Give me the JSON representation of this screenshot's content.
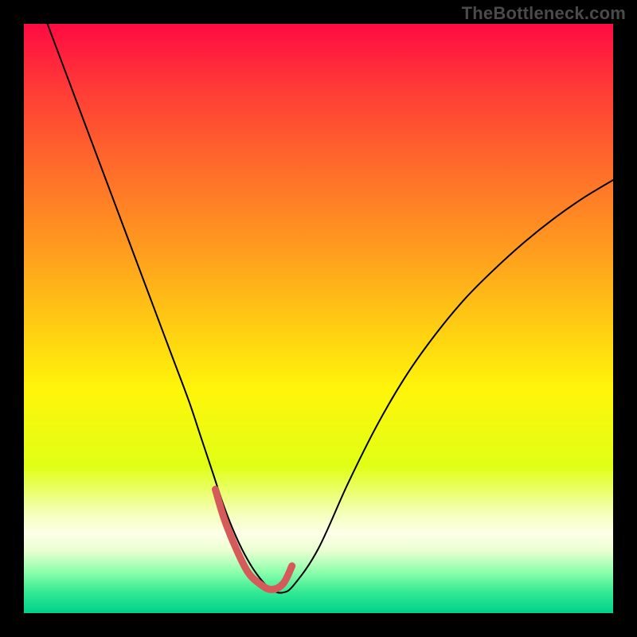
{
  "watermark": "TheBottleneck.com",
  "chart_data": {
    "type": "line",
    "title": "",
    "xlabel": "",
    "ylabel": "",
    "xlim": [
      0,
      100
    ],
    "ylim": [
      0,
      100
    ],
    "grid": false,
    "legend": false,
    "background": {
      "type": "vertical-gradient",
      "stops": [
        {
          "pos": 0.0,
          "color": "#ff0b42"
        },
        {
          "pos": 0.12,
          "color": "#ff3f36"
        },
        {
          "pos": 0.25,
          "color": "#ff6e2a"
        },
        {
          "pos": 0.38,
          "color": "#ff9b1f"
        },
        {
          "pos": 0.5,
          "color": "#ffc814"
        },
        {
          "pos": 0.62,
          "color": "#fff50a"
        },
        {
          "pos": 0.75,
          "color": "#e0ff15"
        },
        {
          "pos": 0.83,
          "color": "#f4ffb8"
        },
        {
          "pos": 0.865,
          "color": "#feffe8"
        },
        {
          "pos": 0.895,
          "color": "#e8ffd0"
        },
        {
          "pos": 0.93,
          "color": "#8dffac"
        },
        {
          "pos": 0.965,
          "color": "#32e993"
        },
        {
          "pos": 1.0,
          "color": "#00d18b"
        }
      ]
    },
    "series": [
      {
        "name": "bottleneck-curve",
        "stroke": "#000000",
        "stroke_width": 2,
        "x": [
          4,
          7,
          10,
          13,
          16,
          19,
          22,
          25,
          28,
          30,
          32,
          34,
          36,
          38,
          40,
          42,
          44,
          46,
          50,
          55,
          60,
          65,
          70,
          75,
          80,
          85,
          90,
          95,
          100
        ],
        "y": [
          100,
          92,
          84,
          76,
          68,
          60,
          52,
          44,
          36,
          30,
          24,
          18,
          13,
          9,
          6,
          4,
          3.5,
          5,
          11,
          22,
          32,
          40.5,
          47.5,
          53.5,
          58.5,
          63,
          67,
          70.5,
          73.5
        ]
      },
      {
        "name": "sweet-spot-highlight",
        "stroke": "#d55a5a",
        "stroke_width": 9,
        "x": [
          32.5,
          34,
          36,
          38,
          40,
          42,
          44,
          45.5
        ],
        "y": [
          21,
          16,
          11,
          7,
          5,
          4,
          5,
          8
        ]
      }
    ]
  }
}
